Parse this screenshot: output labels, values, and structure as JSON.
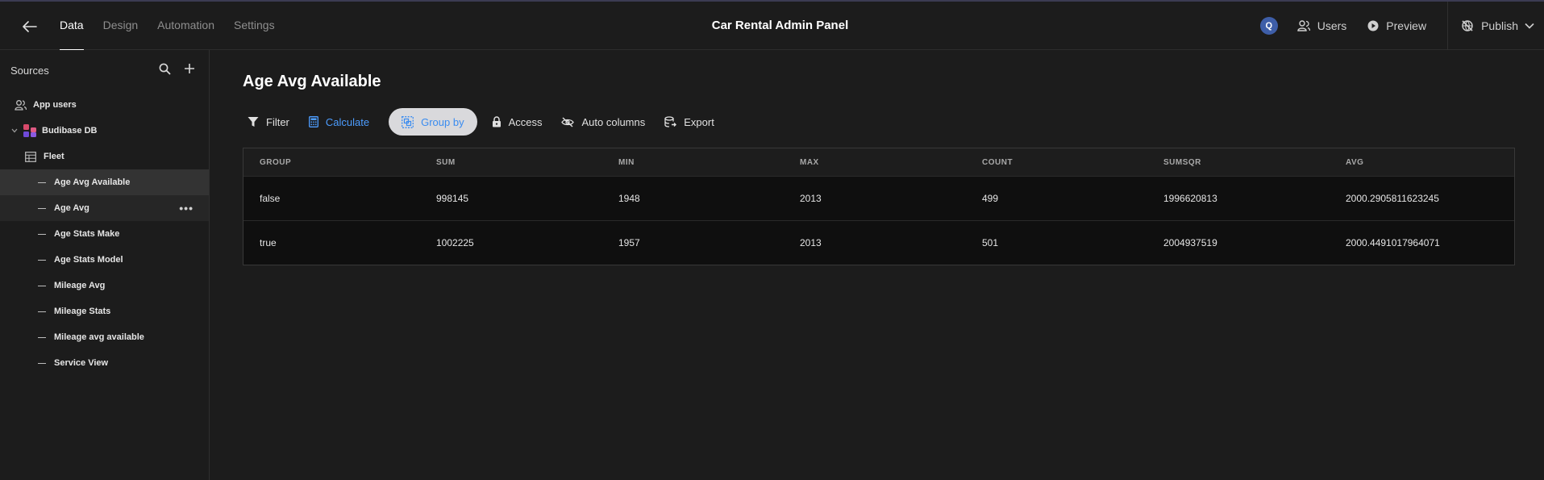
{
  "topbar": {
    "tabs": [
      "Data",
      "Design",
      "Automation",
      "Settings"
    ],
    "app_title": "Car Rental Admin Panel",
    "avatar_initial": "Q",
    "users_label": "Users",
    "preview_label": "Preview",
    "publish_label": "Publish"
  },
  "sidebar": {
    "heading": "Sources",
    "items": [
      {
        "label": "App users",
        "icon": "users-icon"
      },
      {
        "label": "Budibase DB",
        "icon": "budibase-logo"
      },
      {
        "label": "Fleet",
        "icon": "table-icon"
      },
      {
        "label": "Age Avg Available",
        "icon": "view-dash",
        "state": "selected"
      },
      {
        "label": "Age Avg",
        "icon": "view-dash",
        "state": "hovered"
      },
      {
        "label": "Age Stats Make",
        "icon": "view-dash"
      },
      {
        "label": "Age Stats Model",
        "icon": "view-dash"
      },
      {
        "label": "Mileage Avg",
        "icon": "view-dash"
      },
      {
        "label": "Mileage Stats",
        "icon": "view-dash"
      },
      {
        "label": "Mileage avg available",
        "icon": "view-dash"
      },
      {
        "label": "Service View",
        "icon": "view-dash"
      }
    ]
  },
  "main": {
    "title": "Age Avg Available",
    "toolbar": {
      "filter": "Filter",
      "calculate": "Calculate",
      "group_by": "Group by",
      "access": "Access",
      "auto_columns": "Auto columns",
      "export": "Export"
    },
    "table": {
      "columns": [
        "GROUP",
        "SUM",
        "MIN",
        "MAX",
        "COUNT",
        "SUMSQR",
        "AVG"
      ],
      "rows": [
        [
          "false",
          "998145",
          "1948",
          "2013",
          "499",
          "1996620813",
          "2000.2905811623245"
        ],
        [
          "true",
          "1002225",
          "1957",
          "2013",
          "501",
          "2004937519",
          "2000.4491017964071"
        ]
      ]
    }
  },
  "colors": {
    "background": "#1c1c1c",
    "accent_blue": "#4d9dff",
    "avatar_blue": "#3e5ea8",
    "selected_item": "#333333"
  }
}
